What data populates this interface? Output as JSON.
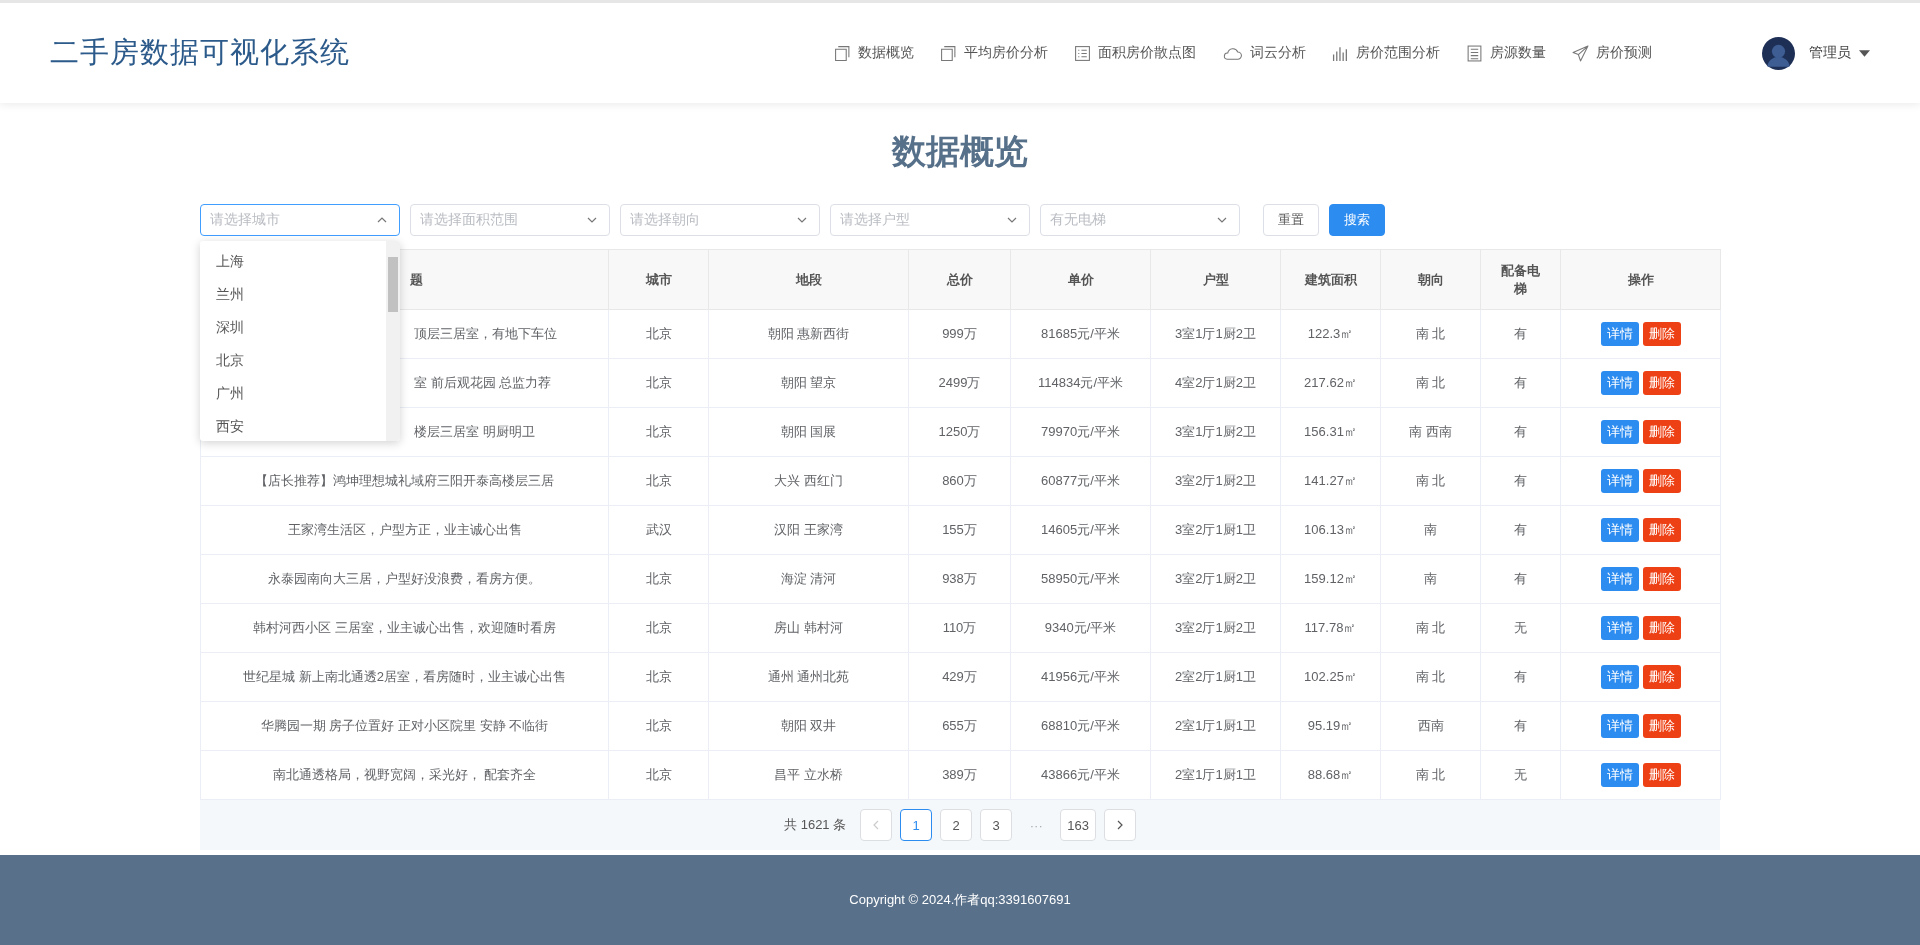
{
  "header": {
    "title": "二手房数据可视化系统",
    "nav": [
      {
        "label": "数据概览",
        "kind": "pages"
      },
      {
        "label": "平均房价分析",
        "kind": "pages"
      },
      {
        "label": "面积房价散点图",
        "kind": "list"
      },
      {
        "label": "词云分析",
        "kind": "cloud"
      },
      {
        "label": "房价范围分析",
        "kind": "bars"
      },
      {
        "label": "房源数量",
        "kind": "doc"
      },
      {
        "label": "房价预测",
        "kind": "plane"
      }
    ],
    "user": {
      "name": "管理员"
    }
  },
  "page_title": "数据概览",
  "filters": [
    {
      "placeholder": "请选择城市",
      "open": true
    },
    {
      "placeholder": "请选择面积范围",
      "open": false
    },
    {
      "placeholder": "请选择朝向",
      "open": false
    },
    {
      "placeholder": "请选择户型",
      "open": false
    },
    {
      "placeholder": "有无电梯",
      "open": false
    }
  ],
  "filter_buttons": [
    {
      "label": "重置",
      "kind": "default"
    },
    {
      "label": "搜索",
      "kind": "primary"
    }
  ],
  "city_dropdown": [
    "上海",
    "兰州",
    "深圳",
    "北京",
    "广州",
    "西安"
  ],
  "table": {
    "columns": [
      "题",
      "城市",
      "地段",
      "总价",
      "单价",
      "户型",
      "建筑面积",
      "朝向",
      "配备电梯",
      "操作"
    ],
    "rows": [
      {
        "title": "顶层三居室，有地下车位",
        "partial": true,
        "city": "北京",
        "district": "朝阳 惠新西街",
        "total": "999万",
        "unit": "81685元/平米",
        "layout": "3室1厅1厨2卫",
        "area": "122.3㎡",
        "orientation": "南 北",
        "elevator": "有",
        "actions": [
          {
            "label": "详情",
            "kind": "primary"
          },
          {
            "label": "删除",
            "kind": "danger"
          }
        ]
      },
      {
        "title": "室 前后观花园 总监力荐",
        "partial": true,
        "city": "北京",
        "district": "朝阳 望京",
        "total": "2499万",
        "unit": "114834元/平米",
        "layout": "4室2厅1厨2卫",
        "area": "217.62㎡",
        "orientation": "南 北",
        "elevator": "有",
        "actions": [
          {
            "label": "详情",
            "kind": "primary"
          },
          {
            "label": "删除",
            "kind": "danger"
          }
        ]
      },
      {
        "title": "楼层三居室 明厨明卫",
        "partial": true,
        "city": "北京",
        "district": "朝阳 国展",
        "total": "1250万",
        "unit": "79970元/平米",
        "layout": "3室1厅1厨2卫",
        "area": "156.31㎡",
        "orientation": "南 西南",
        "elevator": "有",
        "actions": [
          {
            "label": "详情",
            "kind": "primary"
          },
          {
            "label": "删除",
            "kind": "danger"
          }
        ]
      },
      {
        "title": "【店长推荐】鸿坤理想城礼域府三阳开泰高楼层三居",
        "partial": false,
        "city": "北京",
        "district": "大兴 西红门",
        "total": "860万",
        "unit": "60877元/平米",
        "layout": "3室2厅1厨2卫",
        "area": "141.27㎡",
        "orientation": "南 北",
        "elevator": "有",
        "actions": [
          {
            "label": "详情",
            "kind": "primary"
          },
          {
            "label": "删除",
            "kind": "danger"
          }
        ]
      },
      {
        "title": "王家湾生活区，户型方正，业主诚心出售",
        "partial": false,
        "city": "武汉",
        "district": "汉阳 王家湾",
        "total": "155万",
        "unit": "14605元/平米",
        "layout": "3室2厅1厨1卫",
        "area": "106.13㎡",
        "orientation": "南",
        "elevator": "有",
        "actions": [
          {
            "label": "详情",
            "kind": "primary"
          },
          {
            "label": "删除",
            "kind": "danger"
          }
        ]
      },
      {
        "title": "永泰园南向大三居，户型好没浪费，看房方便。",
        "partial": false,
        "city": "北京",
        "district": "海淀 清河",
        "total": "938万",
        "unit": "58950元/平米",
        "layout": "3室2厅1厨2卫",
        "area": "159.12㎡",
        "orientation": "南",
        "elevator": "有",
        "actions": [
          {
            "label": "详情",
            "kind": "primary"
          },
          {
            "label": "删除",
            "kind": "danger"
          }
        ]
      },
      {
        "title": "韩村河西小区 三居室，业主诚心出售，欢迎随时看房",
        "partial": false,
        "city": "北京",
        "district": "房山 韩村河",
        "total": "110万",
        "unit": "9340元/平米",
        "layout": "3室2厅1厨2卫",
        "area": "117.78㎡",
        "orientation": "南 北",
        "elevator": "无",
        "actions": [
          {
            "label": "详情",
            "kind": "primary"
          },
          {
            "label": "删除",
            "kind": "danger"
          }
        ]
      },
      {
        "title": "世纪星城 新上南北通透2居室，看房随时，业主诚心出售",
        "partial": false,
        "city": "北京",
        "district": "通州 通州北苑",
        "total": "429万",
        "unit": "41956元/平米",
        "layout": "2室2厅1厨1卫",
        "area": "102.25㎡",
        "orientation": "南 北",
        "elevator": "有",
        "actions": [
          {
            "label": "详情",
            "kind": "primary"
          },
          {
            "label": "删除",
            "kind": "danger"
          }
        ]
      },
      {
        "title": "华腾园一期 房子位置好 正对小区院里 安静 不临街",
        "partial": false,
        "city": "北京",
        "district": "朝阳 双井",
        "total": "655万",
        "unit": "68810元/平米",
        "layout": "2室1厅1厨1卫",
        "area": "95.19㎡",
        "orientation": "西南",
        "elevator": "有",
        "actions": [
          {
            "label": "详情",
            "kind": "primary"
          },
          {
            "label": "删除",
            "kind": "danger"
          }
        ]
      },
      {
        "title": "南北通透格局，视野宽阔，采光好， 配套齐全",
        "partial": false,
        "city": "北京",
        "district": "昌平 立水桥",
        "total": "389万",
        "unit": "43866元/平米",
        "layout": "2室1厅1厨1卫",
        "area": "88.68㎡",
        "orientation": "南 北",
        "elevator": "无",
        "actions": [
          {
            "label": "详情",
            "kind": "primary"
          },
          {
            "label": "删除",
            "kind": "danger"
          }
        ]
      }
    ]
  },
  "pagination": {
    "total": "共 1621 条",
    "prev_disabled": true,
    "pages": [
      {
        "label": "1",
        "selected": true
      },
      {
        "label": "2",
        "selected": false
      },
      {
        "label": "3",
        "selected": false
      },
      {
        "label": "···",
        "selected": false,
        "kind": "ellipsis"
      },
      {
        "label": "163",
        "selected": false
      }
    ]
  },
  "footer": {
    "copyright": "Copyright © 2024.作者qq:3391607691"
  }
}
